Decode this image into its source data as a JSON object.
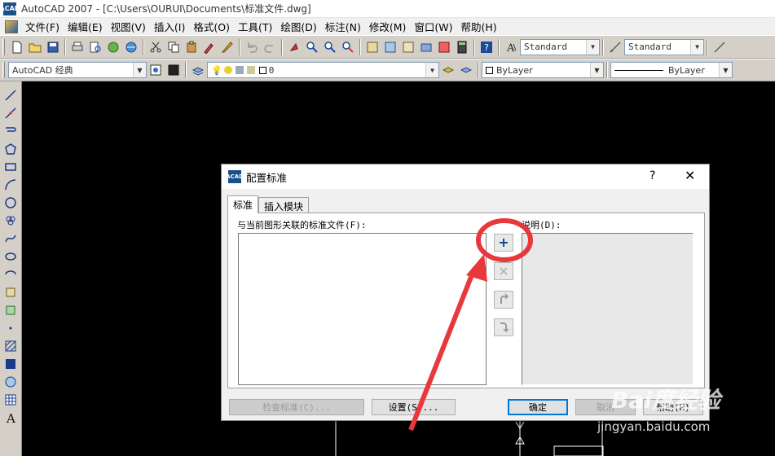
{
  "window": {
    "title": "AutoCAD 2007 - [C:\\Users\\OURUI\\Documents\\标准文件.dwg]",
    "icon_label": "ACAD"
  },
  "menu": [
    "文件(F)",
    "编辑(E)",
    "视图(V)",
    "插入(I)",
    "格式(O)",
    "工具(T)",
    "绘图(D)",
    "标注(N)",
    "修改(M)",
    "窗口(W)",
    "帮助(H)"
  ],
  "toolbar1": {
    "text_style": "Standard",
    "dim_style": "Standard"
  },
  "toolbar2": {
    "workspace": "AutoCAD 经典",
    "layer": "0",
    "color": "ByLayer",
    "linetype": "ByLayer"
  },
  "dialog": {
    "title": "配置标准",
    "help": "?",
    "close": "✕",
    "tabs": [
      "标准",
      "插入模块"
    ],
    "list_label": "与当前图形关联的标准文件(F):",
    "desc_label": "说明(D):",
    "buttons": {
      "check": "检查标准(C)...",
      "settings": "设置(S)...",
      "ok": "确定",
      "cancel": "取消",
      "help": "帮助(H)"
    }
  },
  "watermark": {
    "logo": "Bai度经验",
    "url": "jingyan.baidu.com"
  },
  "colors": {
    "annotation": "#e8383b",
    "canvas": "#000000",
    "dialog_bg": "#f0f0f0",
    "default_button_border": "#0078d7"
  }
}
